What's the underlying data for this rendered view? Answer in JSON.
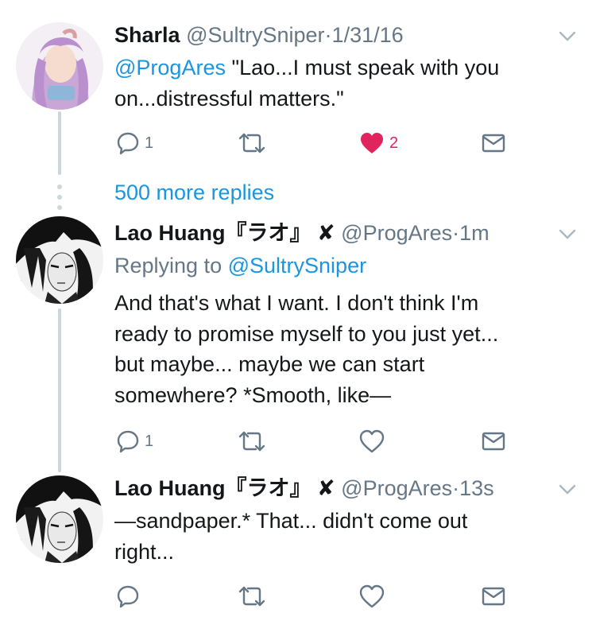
{
  "tweets": [
    {
      "name": "Sharla",
      "handle": "@SultrySniper",
      "sep": "·",
      "time": "1/31/16",
      "mention": "@ProgAres",
      "text_line1": "\"Lao...I must speak with you",
      "text_line2": "on...distressful matters.\"",
      "reply_count": "1",
      "like_count": "2",
      "liked": true
    },
    {
      "name": "Lao Huang『ラオ』",
      "name_mark": "✘",
      "handle": "@ProgAres",
      "sep": "·",
      "time": "1m",
      "replying_prefix": "Replying to",
      "replying_to": "@SultrySniper",
      "text_lines": [
        "And that's what I want. I don't think I'm",
        "ready to promise myself to you just yet...",
        "but maybe... maybe we can start",
        "somewhere? *Smooth, like—"
      ],
      "reply_count": "1"
    },
    {
      "name": "Lao Huang『ラオ』",
      "name_mark": "✘",
      "handle": "@ProgAres",
      "sep": "·",
      "time": "13s",
      "text_lines": [
        "—sandpaper.* That... didn't come out",
        "right..."
      ]
    }
  ],
  "more_replies": "500 more replies",
  "colors": {
    "link": "#1b95e0",
    "muted": "#657786",
    "like": "#e0245e",
    "thread_line": "#ccd6dd"
  },
  "icons": [
    "reply-icon",
    "retweet-icon",
    "heart-icon",
    "dm-icon",
    "chevron-down-icon"
  ]
}
